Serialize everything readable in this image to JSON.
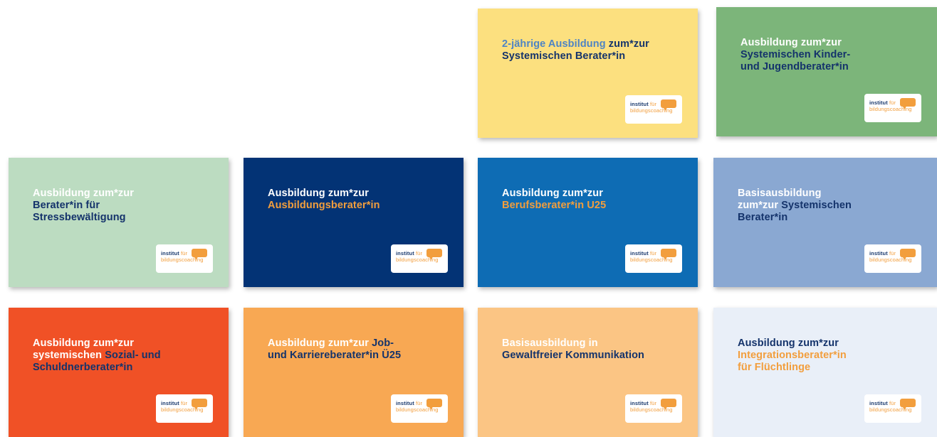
{
  "logo": {
    "line1_a": "institut",
    "line1_b": "für",
    "line2": "bildungscoaching"
  },
  "cards": [
    {
      "id": "card-systemischer-berater-2j",
      "background": "#fce07f",
      "segments": [
        {
          "text": "2-jährige Ausbildung ",
          "color": "#4e84c4"
        },
        {
          "text": "zum*zur",
          "color": "#14336b",
          "br": true
        },
        {
          "text": "Systemischen Berater*in",
          "color": "#14336b"
        }
      ]
    },
    {
      "id": "card-kinder-jugendberater",
      "background": "#7cb57a",
      "segments": [
        {
          "text": "Ausbildung zum*zur",
          "color": "#ffffff",
          "br": true
        },
        {
          "text": "Systemischen Kinder-",
          "color": "#14336b",
          "br": true
        },
        {
          "text": "und Jugendberater*in",
          "color": "#14336b"
        }
      ]
    },
    {
      "id": "card-stressbewaeltigung",
      "background": "#bcdcc1",
      "segments": [
        {
          "text": "Ausbildung zum*zur",
          "color": "#ffffff",
          "br": true
        },
        {
          "text": "Berater*in für",
          "color": "#14336b",
          "br": true
        },
        {
          "text": "Stressbewältigung",
          "color": "#14336b"
        }
      ]
    },
    {
      "id": "card-ausbildungsberater",
      "background": "#033375",
      "segments": [
        {
          "text": "Ausbildung zum*zur",
          "color": "#ffffff",
          "br": true
        },
        {
          "text": "Ausbildungsberater*in",
          "color": "#f29e3d"
        }
      ]
    },
    {
      "id": "card-berufsberater-u25",
      "background": "#0e6cb4",
      "segments": [
        {
          "text": "Ausbildung zum*zur",
          "color": "#ffffff",
          "br": true
        },
        {
          "text": "Berufsberater*in U25",
          "color": "#f29e3d"
        }
      ]
    },
    {
      "id": "card-basisausbildung-systemisch",
      "background": "#8aa8d2",
      "segments": [
        {
          "text": "Basisausbildung",
          "color": "#ffffff",
          "br": true
        },
        {
          "text": "zum*zur ",
          "color": "#ffffff"
        },
        {
          "text": "Systemischen",
          "color": "#14336b",
          "br": true
        },
        {
          "text": "Berater*in",
          "color": "#14336b"
        }
      ]
    },
    {
      "id": "card-sozial-schuldnerberater",
      "background": "#f05126",
      "segments": [
        {
          "text": "Ausbildung zum*zur",
          "color": "#ffffff",
          "br": true
        },
        {
          "text": "systemischen ",
          "color": "#ffffff"
        },
        {
          "text": "Sozial- und",
          "color": "#14336b",
          "br": true
        },
        {
          "text": "Schuldnerberater*in",
          "color": "#14336b"
        }
      ]
    },
    {
      "id": "card-karriereberater-ue25",
      "background": "#f8a853",
      "segments": [
        {
          "text": "Ausbildung zum*zur ",
          "color": "#ffffff"
        },
        {
          "text": "Job-",
          "color": "#14336b",
          "br": true
        },
        {
          "text": "und Karriereberater*in Ü25",
          "color": "#14336b"
        }
      ]
    },
    {
      "id": "card-gewaltfreie-kommunikation",
      "background": "#fbc584",
      "segments": [
        {
          "text": "Basisausbildung in",
          "color": "#ffffff",
          "br": true
        },
        {
          "text": "Gewaltfreier Kommunikation",
          "color": "#14336b"
        }
      ]
    },
    {
      "id": "card-integrationsberater",
      "background": "#e9eff8",
      "segments": [
        {
          "text": "Ausbildung zum*zur",
          "color": "#14336b",
          "br": true
        },
        {
          "text": "Integrationsberater*in",
          "color": "#f29e3d",
          "br": true
        },
        {
          "text": "für Flüchtlinge",
          "color": "#f29e3d"
        }
      ]
    }
  ]
}
